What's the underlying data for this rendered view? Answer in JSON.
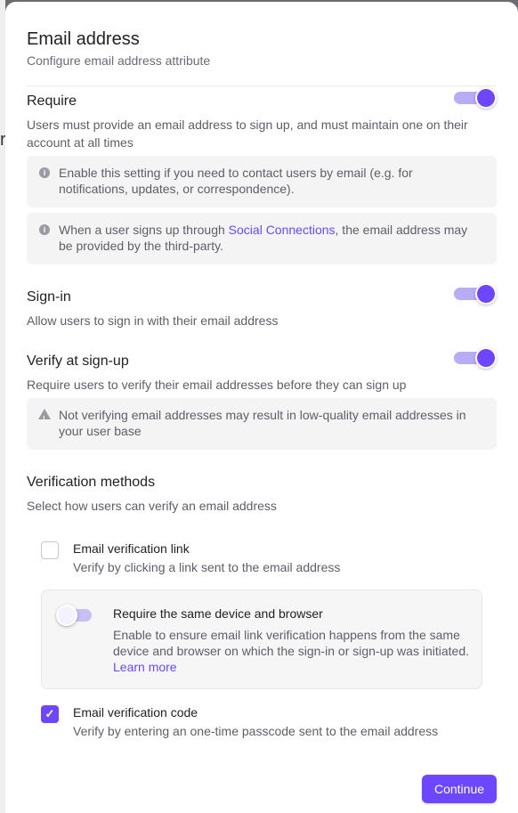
{
  "backdrop": {
    "glyph": "r"
  },
  "modal": {
    "title": "Email address",
    "subtitle": "Configure email address attribute"
  },
  "require": {
    "title": "Require",
    "description": "Users must provide an email address to sign up, and must maintain one on their account at all times",
    "enabled": true,
    "info_1": "Enable this setting if you need to contact users by email (e.g. for notifications, updates, or correspondence).",
    "info_2_before": "When a user signs up through ",
    "info_2_link": "Social Connections",
    "info_2_after": ", the email address may be provided by the third-party."
  },
  "signin": {
    "title": "Sign-in",
    "description": "Allow users to sign in with their email address",
    "enabled": true
  },
  "verify": {
    "title": "Verify at sign-up",
    "description": "Require users to verify their email addresses before they can sign up",
    "enabled": true,
    "warning": "Not verifying email addresses may result in low-quality email addresses in your user base"
  },
  "methods": {
    "title": "Verification methods",
    "description": "Select how users can verify an email address",
    "link_option": {
      "title": "Email verification link",
      "description": "Verify by clicking a link sent to the email address",
      "checked": false
    },
    "same_device": {
      "title": "Require the same device and browser",
      "description": "Enable to ensure email link verification happens from the same device and browser on which the sign-in or sign-up was initiated. ",
      "link": "Learn more",
      "enabled": false
    },
    "code_option": {
      "title": "Email verification code",
      "description": "Verify by entering an one-time passcode sent to the email address",
      "checked": true
    }
  },
  "footer": {
    "continue_label": "Continue"
  },
  "icons": {
    "info": "info-icon",
    "warning": "warning-icon",
    "check": "check-icon"
  },
  "colors": {
    "accent": "#6c47ff",
    "accent_light": "#b8acf6"
  }
}
